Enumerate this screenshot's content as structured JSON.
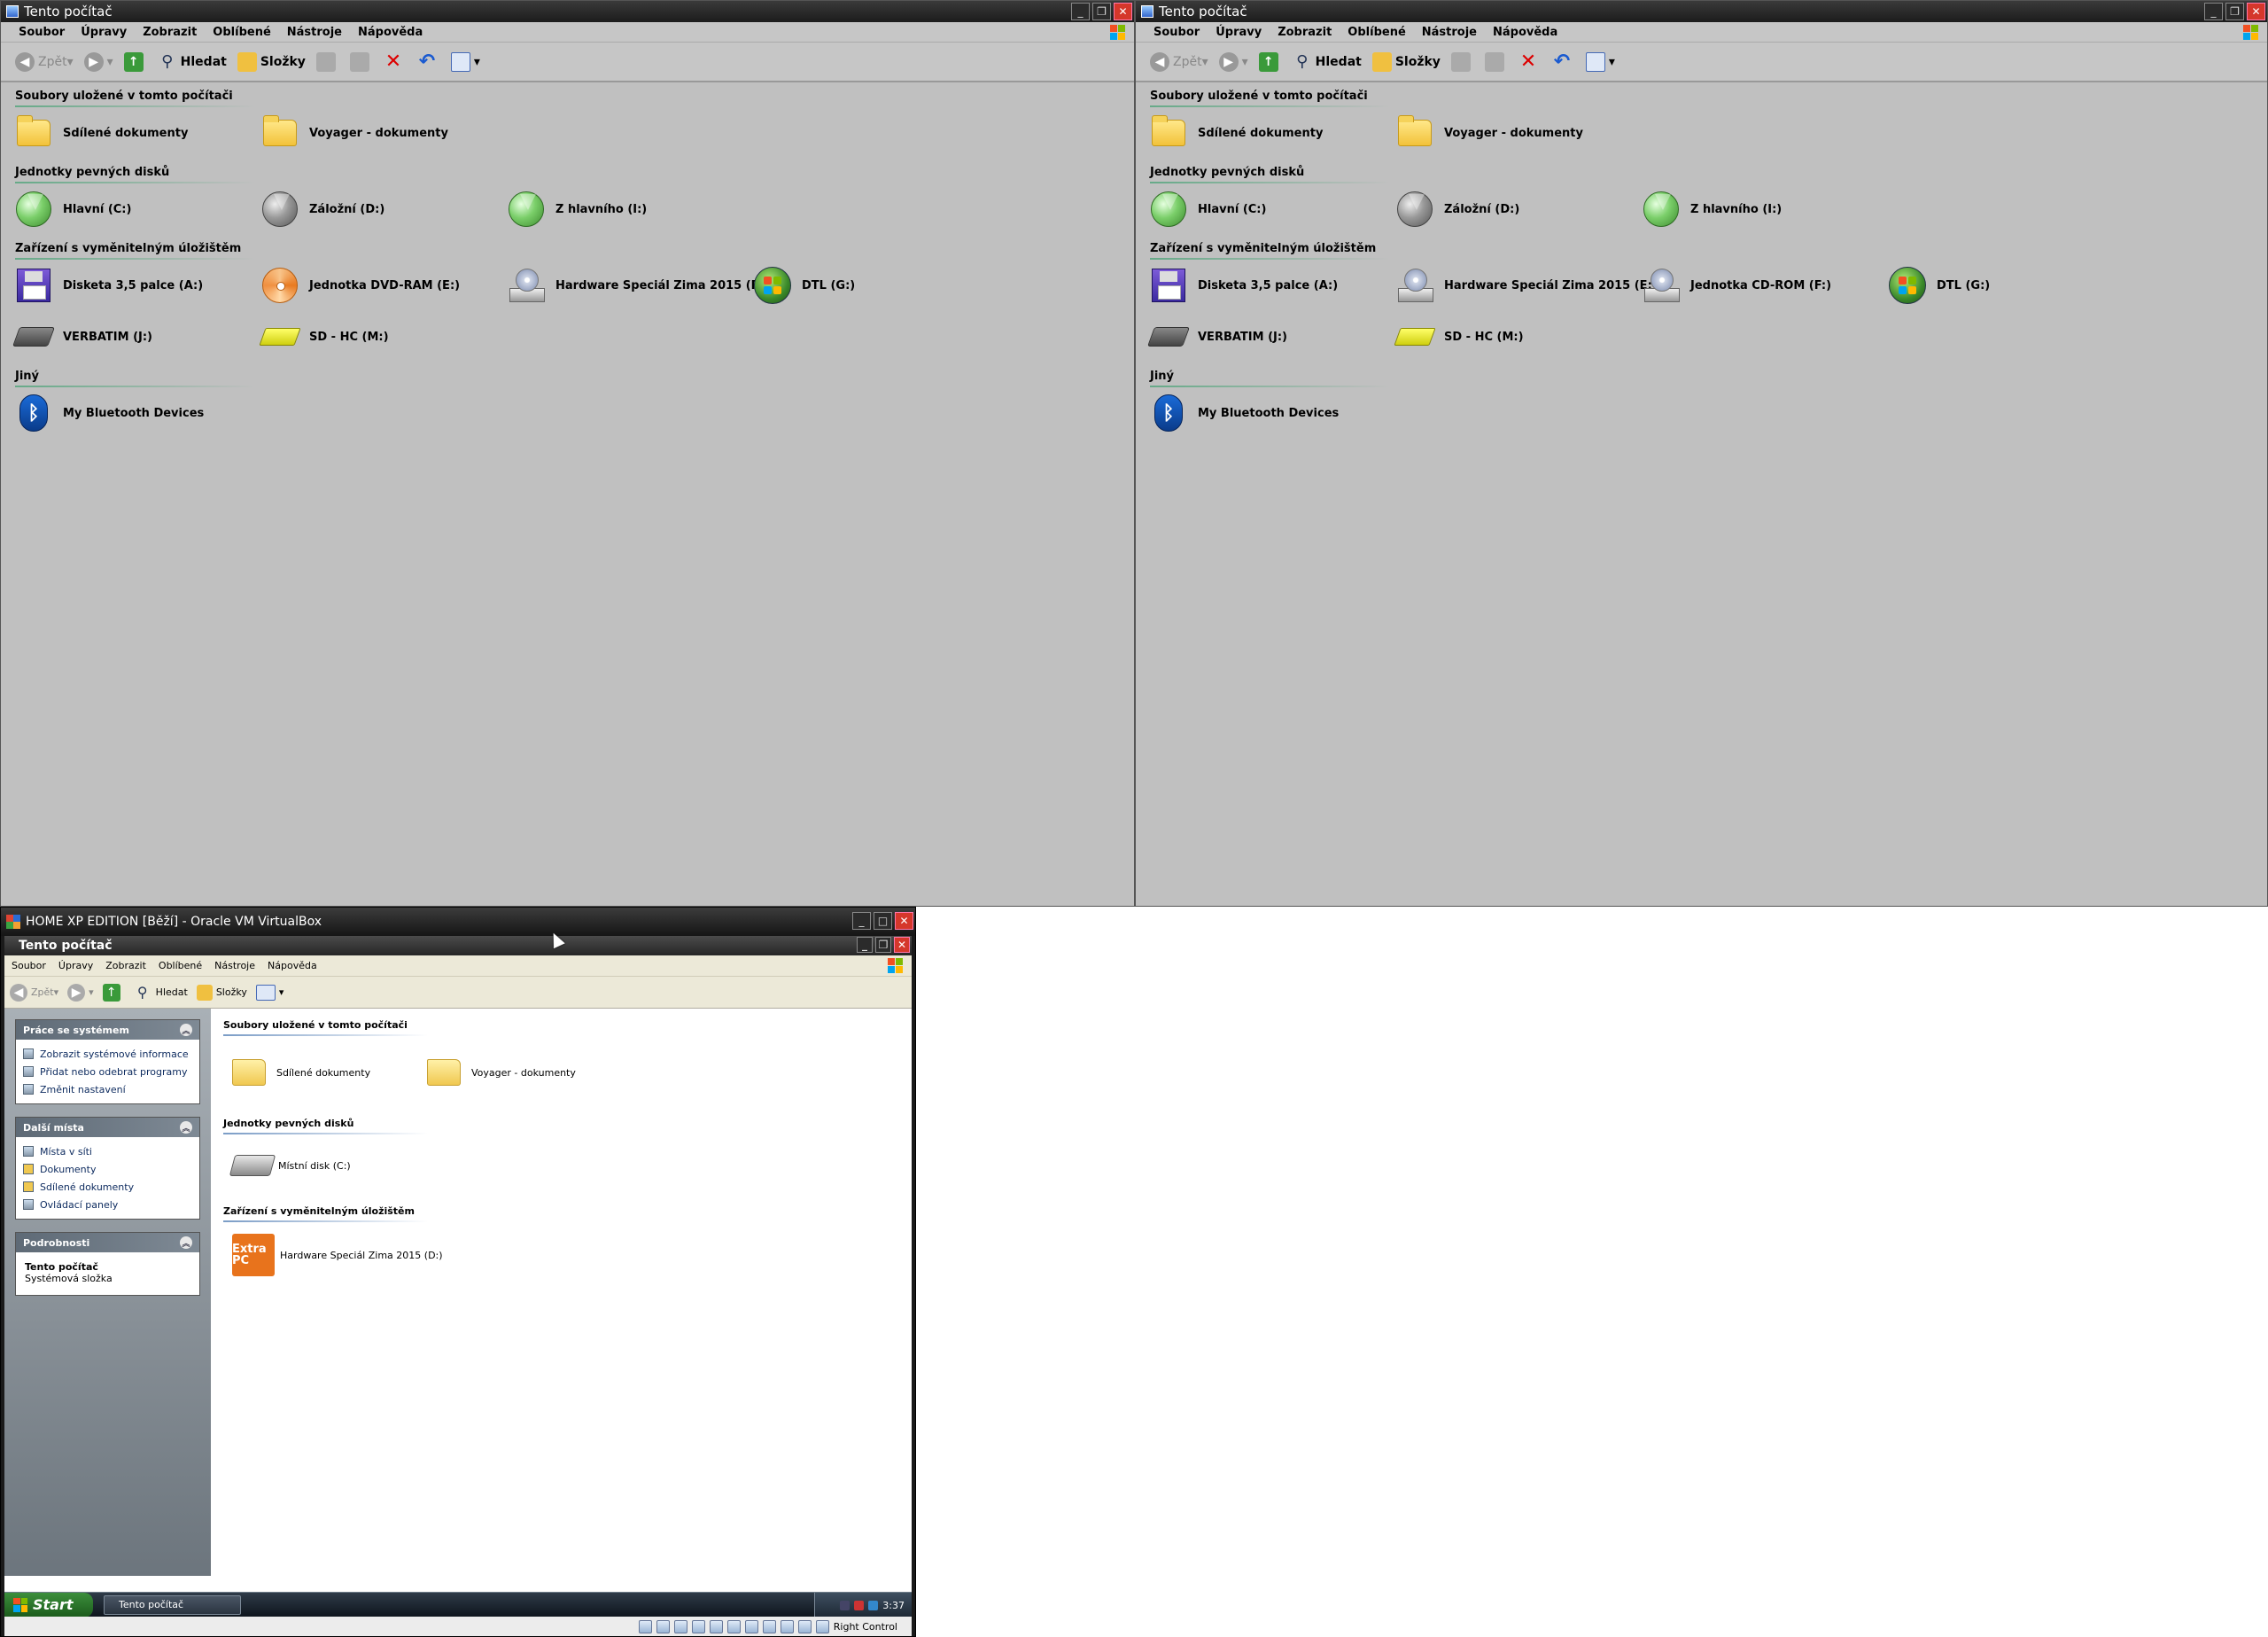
{
  "windows": [
    {
      "title": "Tento počítač",
      "menu": [
        "Soubor",
        "Úpravy",
        "Zobrazit",
        "Oblíbené",
        "Nástroje",
        "Nápověda"
      ],
      "toolbar": {
        "back": "Zpět",
        "search": "Hledat",
        "folders": "Složky"
      },
      "groups": [
        {
          "title": "Soubory uložené v tomto počítači",
          "rows": [
            [
              {
                "label": "Sdílené dokumenty",
                "icon": "folder-icon"
              },
              {
                "label": "Voyager - dokumenty",
                "icon": "folder-icon"
              }
            ]
          ]
        },
        {
          "title": "Jednotky pevných disků",
          "rows": [
            [
              {
                "label": "Hlavní (C:)",
                "icon": "disk-green-icon"
              },
              {
                "label": "Záložní (D:)",
                "icon": "disk-gray-icon"
              },
              {
                "label": "Z hlavního (I:)",
                "icon": "disk-green-icon"
              }
            ]
          ]
        },
        {
          "title": "Zařízení s vyměnitelným úložištěm",
          "rows": [
            [
              {
                "label": "Disketa 3,5 palce (A:)",
                "icon": "floppy-icon"
              },
              {
                "label": "Jednotka DVD-RAM (E:)",
                "icon": "dvd-icon"
              },
              {
                "label": "Hardware Speciál Zima 2015 (F:)",
                "icon": "cdrom-icon"
              },
              {
                "label": "DTL (G:)",
                "icon": "windows-orb-icon"
              }
            ],
            [
              {
                "label": "VERBATIM (J:)",
                "icon": "usb-drive-icon"
              },
              {
                "label": "SD - HC (M:)",
                "icon": "sd-card-icon"
              }
            ]
          ]
        },
        {
          "title": "Jiný",
          "rows": [
            [
              {
                "label": "My Bluetooth Devices",
                "icon": "bluetooth-icon"
              }
            ]
          ]
        }
      ]
    },
    {
      "title": "Tento počítač",
      "menu": [
        "Soubor",
        "Úpravy",
        "Zobrazit",
        "Oblíbené",
        "Nástroje",
        "Nápověda"
      ],
      "toolbar": {
        "back": "Zpět",
        "search": "Hledat",
        "folders": "Složky"
      },
      "groups": [
        {
          "title": "Soubory uložené v tomto počítači",
          "rows": [
            [
              {
                "label": "Sdílené dokumenty",
                "icon": "folder-icon"
              },
              {
                "label": "Voyager - dokumenty",
                "icon": "folder-icon"
              }
            ]
          ]
        },
        {
          "title": "Jednotky pevných disků",
          "rows": [
            [
              {
                "label": "Hlavní (C:)",
                "icon": "disk-green-icon"
              },
              {
                "label": "Záložní (D:)",
                "icon": "disk-gray-icon"
              },
              {
                "label": "Z hlavního (I:)",
                "icon": "disk-green-icon"
              }
            ]
          ]
        },
        {
          "title": "Zařízení s vyměnitelným úložištěm",
          "rows": [
            [
              {
                "label": "Disketa 3,5 palce (A:)",
                "icon": "floppy-icon"
              },
              {
                "label": "Hardware Speciál Zima 2015 (E:)",
                "icon": "cdrom-icon"
              },
              {
                "label": "Jednotka CD-ROM (F:)",
                "icon": "cdrom-icon"
              },
              {
                "label": "DTL (G:)",
                "icon": "windows-orb-icon"
              }
            ],
            [
              {
                "label": "VERBATIM (J:)",
                "icon": "usb-drive-icon"
              },
              {
                "label": "SD - HC (M:)",
                "icon": "sd-card-icon"
              }
            ]
          ]
        },
        {
          "title": "Jiný",
          "rows": [
            [
              {
                "label": "My Bluetooth Devices",
                "icon": "bluetooth-icon"
              }
            ]
          ]
        }
      ]
    }
  ],
  "vbox": {
    "title": "HOME XP EDITION [Běží] - Oracle VM VirtualBox",
    "status_right": "Right Control",
    "guest": {
      "title": "Tento počítač",
      "menu": [
        "Soubor",
        "Úpravy",
        "Zobrazit",
        "Oblíbené",
        "Nástroje",
        "Nápověda"
      ],
      "toolbar": {
        "back": "Zpět",
        "search": "Hledat",
        "folders": "Složky"
      },
      "panels": [
        {
          "title": "Práce se systémem",
          "links": [
            "Zobrazit systémové informace",
            "Přidat nebo odebrat programy",
            "Změnit nastavení"
          ]
        },
        {
          "title": "Další místa",
          "links": [
            "Místa v síti",
            "Dokumenty",
            "Sdílené dokumenty",
            "Ovládací panely"
          ]
        }
      ],
      "details": {
        "title": "Podrobnosti",
        "name": "Tento počítač",
        "type": "Systémová složka"
      },
      "groups": [
        {
          "title": "Soubory uložené v tomto počítači",
          "items": [
            "Sdílené dokumenty",
            "Voyager - dokumenty"
          ]
        },
        {
          "title": "Jednotky pevných disků",
          "items": [
            "Místní disk (C:)"
          ]
        },
        {
          "title": "Zařízení s vyměnitelným úložištěm",
          "items": [
            "Hardware Speciál Zima 2015 (D:)"
          ]
        }
      ],
      "extrapc_logo": "Extra PC",
      "taskbar": {
        "start": "Start",
        "task": "Tento počítač",
        "clock": "3:37"
      }
    }
  },
  "colors": {
    "xp_red": "#f25022",
    "xp_green": "#7fba00",
    "xp_blue": "#00a4ef",
    "xp_yellow": "#ffb900"
  }
}
